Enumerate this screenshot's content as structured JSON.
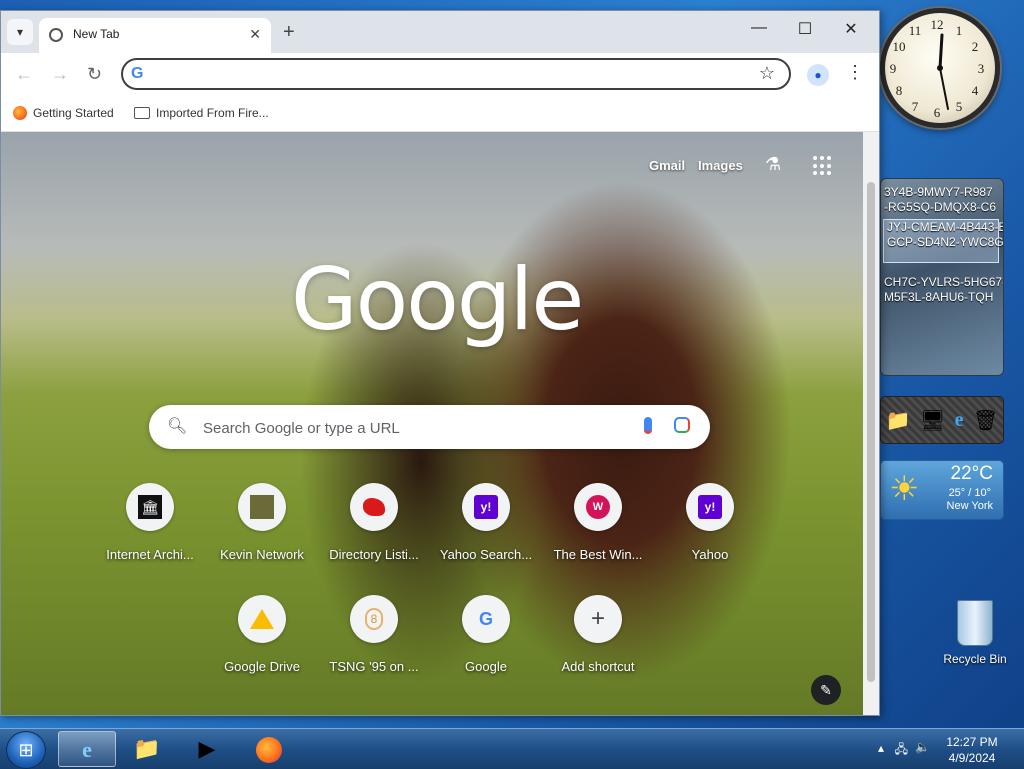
{
  "browser": {
    "tab_title": "New Tab",
    "address_value": "",
    "bookmarks": [
      "Getting Started",
      "Imported From Fire..."
    ]
  },
  "ntp": {
    "links": [
      "Gmail",
      "Images"
    ],
    "logo": "Google",
    "search_placeholder": "Search Google or type a URL",
    "shortcuts": [
      {
        "label": "Internet Archi...",
        "icon": "internet-archive-icon"
      },
      {
        "label": "Kevin Network",
        "icon": "kevin-network-icon"
      },
      {
        "label": "Directory Listi...",
        "icon": "directory-listing-icon"
      },
      {
        "label": "Yahoo Search...",
        "icon": "yahoo-icon"
      },
      {
        "label": "The Best Win...",
        "icon": "w-icon"
      },
      {
        "label": "Yahoo",
        "icon": "yahoo-icon"
      },
      {
        "label": "Google Drive",
        "icon": "google-drive-icon"
      },
      {
        "label": "TSNG '95 on ...",
        "icon": "tsng-icon"
      },
      {
        "label": "Google",
        "icon": "google-g-icon"
      },
      {
        "label": "Add shortcut",
        "icon": "plus-icon"
      }
    ]
  },
  "desktop": {
    "product_keys": [
      "3Y4B-9MWY7-R987",
      "-RG5SQ-DMQX8-C6",
      "JYJ-CMEAM-4B443-E",
      "GCP-SD4N2-YWC8G-",
      "CH7C-YVLRS-5HG67-",
      "M5F3L-8AHU6-TQH"
    ],
    "weather": {
      "temp": "22°C",
      "hilo": "25° / 10°",
      "city": "New York"
    },
    "recycle_bin": "Recycle Bin"
  },
  "taskbar": {
    "time": "12:27 PM",
    "date": "4/9/2024"
  },
  "colors": {
    "accent": "#1a73e8",
    "taskbar": "#1f4f86"
  }
}
